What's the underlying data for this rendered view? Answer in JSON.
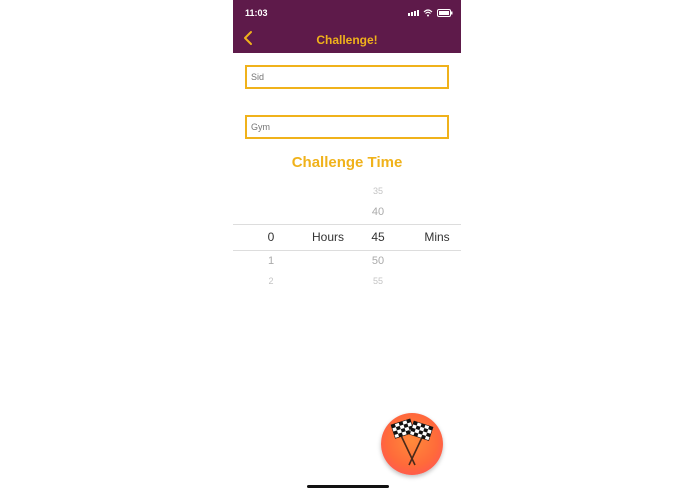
{
  "status": {
    "time": "11:03"
  },
  "nav": {
    "title": "Challenge!"
  },
  "form": {
    "name_placeholder": "Sid",
    "location_placeholder": "Gym"
  },
  "section": {
    "title": "Challenge Time"
  },
  "picker": {
    "hours_column": [
      "0",
      "1",
      "2"
    ],
    "hours_selected": "0",
    "hours_label": "Hours",
    "minutes_column": [
      "35",
      "40",
      "45",
      "50",
      "55"
    ],
    "minutes_selected": "45",
    "mins_label": "Mins"
  },
  "icons": {
    "back": "chevron-left-icon",
    "start": "checkered-flags-icon"
  },
  "colors": {
    "nav_bg": "#5e1a4a",
    "accent": "#f0b21b",
    "fab_gradient_start": "#ff8a3a",
    "fab_gradient_end": "#ff4a62"
  }
}
